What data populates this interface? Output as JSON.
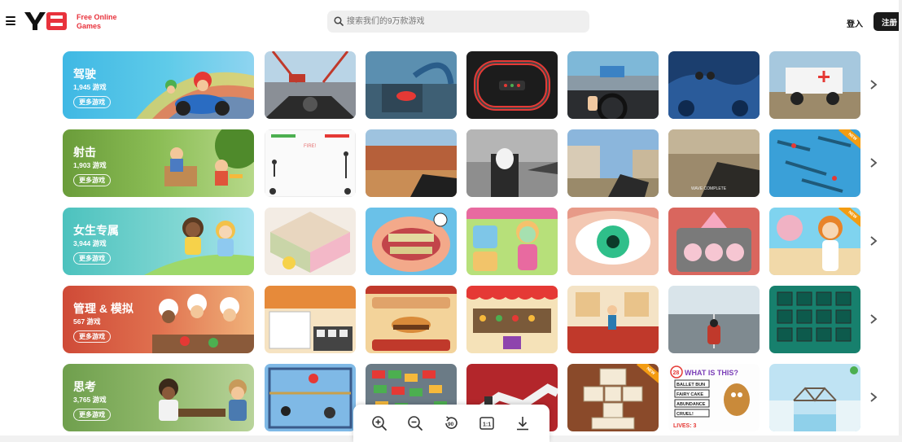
{
  "header": {
    "logo_text_line1": "Free Online",
    "logo_text_line2": "Games",
    "search_placeholder": "搜索我们的9万款游戏",
    "login_label": "登入",
    "signup_label": "注册"
  },
  "categories": [
    {
      "title": "驾驶",
      "count": "1,945 游戏",
      "more": "更多游戏"
    },
    {
      "title": "射击",
      "count": "1,903 游戏",
      "more": "更多游戏"
    },
    {
      "title": "女生专属",
      "count": "3,944 游戏",
      "more": "更多游戏"
    },
    {
      "title": "管理 & 模拟",
      "count": "567 游戏",
      "more": "更多游戏"
    },
    {
      "title": "思考",
      "count": "3,765 游戏",
      "more": "更多游戏"
    }
  ],
  "thumb_labels": {
    "new_badge": "NEW",
    "wave_complete": "WAVE COMPLETE",
    "what_is_this": "WHAT IS THIS?",
    "ballet_bun": "BALLET BUN",
    "fairy_cake": "FAIRY CAKE",
    "abundance": "ABUNDANCE",
    "cruel": "CRUEL!",
    "lives": "LIVES: 3",
    "level_number": "28"
  },
  "toolbar": {
    "icons": [
      "zoom-in-icon",
      "zoom-out-icon",
      "rotate-90-icon",
      "actual-size-icon",
      "download-icon"
    ],
    "rotate_label": "90",
    "actual_size_label": "1:1"
  },
  "colors": {
    "driving": "#4ec3e6",
    "shooting": "#6fa23f",
    "girls": "#56c9c4",
    "management": "#d9533e",
    "thinking": "#79a858",
    "brand_red": "#e8323c"
  }
}
